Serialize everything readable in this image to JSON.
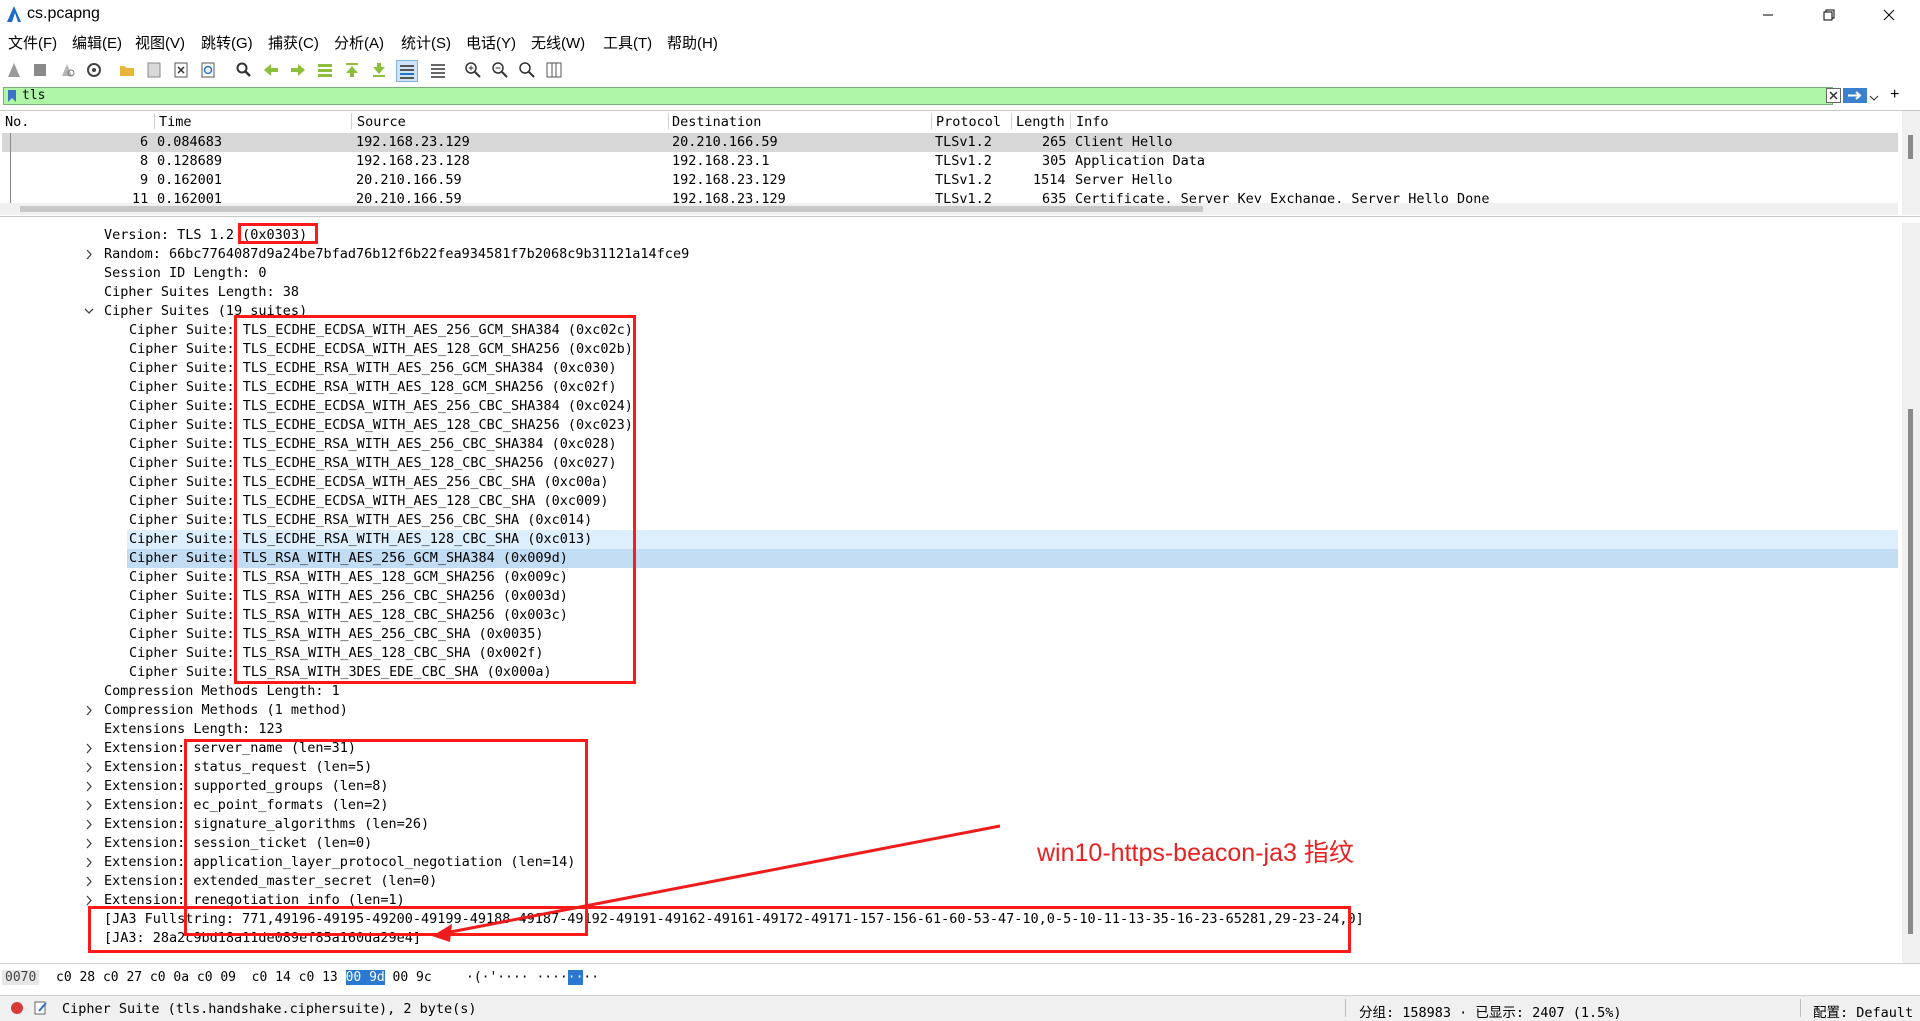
{
  "window": {
    "title": "cs.pcapng"
  },
  "menu": [
    "文件(F)",
    "编辑(E)",
    "视图(V)",
    "跳转(G)",
    "捕获(C)",
    "分析(A)",
    "统计(S)",
    "电话(Y)",
    "无线(W)",
    "工具(T)",
    "帮助(H)"
  ],
  "filter": {
    "value": "tls"
  },
  "packet_list": {
    "columns": [
      "No.",
      "Time",
      "Source",
      "Destination",
      "Protocol",
      "Length",
      "Info"
    ],
    "rows": [
      {
        "no": "6",
        "time": "0.084683",
        "src": "192.168.23.129",
        "dst": "20.210.166.59",
        "proto": "TLSv1.2",
        "len": "265",
        "info": "Client Hello",
        "selected": true
      },
      {
        "no": "8",
        "time": "0.128689",
        "src": "192.168.23.128",
        "dst": "192.168.23.1",
        "proto": "TLSv1.2",
        "len": "305",
        "info": "Application Data"
      },
      {
        "no": "9",
        "time": "0.162001",
        "src": "20.210.166.59",
        "dst": "192.168.23.129",
        "proto": "TLSv1.2",
        "len": "1514",
        "info": "Server Hello"
      },
      {
        "no": "11",
        "time": "0.162001",
        "src": "20.210.166.59",
        "dst": "192.168.23.129",
        "proto": "TLSv1.2",
        "len": "635",
        "info": "Certificate, Server Key Exchange, Server Hello Done"
      }
    ]
  },
  "details": {
    "version": {
      "label": "Version: TLS 1.2 ",
      "value": "(0x0303)"
    },
    "random": "Random: 66bc7764087d9a24be7bfad76b12f6b22fea934581f7b2068c9b31121a14fce9",
    "session_id_length": "Session ID Length: 0",
    "cipher_suites_length": "Cipher Suites Length: 38",
    "cipher_suites_header": "Cipher Suites (19 suites)",
    "cipher_prefix": "Cipher Suite: ",
    "cipher_suites": [
      "TLS_ECDHE_ECDSA_WITH_AES_256_GCM_SHA384 (0xc02c)",
      "TLS_ECDHE_ECDSA_WITH_AES_128_GCM_SHA256 (0xc02b)",
      "TLS_ECDHE_RSA_WITH_AES_256_GCM_SHA384 (0xc030)",
      "TLS_ECDHE_RSA_WITH_AES_128_GCM_SHA256 (0xc02f)",
      "TLS_ECDHE_ECDSA_WITH_AES_256_CBC_SHA384 (0xc024)",
      "TLS_ECDHE_ECDSA_WITH_AES_128_CBC_SHA256 (0xc023)",
      "TLS_ECDHE_RSA_WITH_AES_256_CBC_SHA384 (0xc028)",
      "TLS_ECDHE_RSA_WITH_AES_128_CBC_SHA256 (0xc027)",
      "TLS_ECDHE_ECDSA_WITH_AES_256_CBC_SHA (0xc00a)",
      "TLS_ECDHE_ECDSA_WITH_AES_128_CBC_SHA (0xc009)",
      "TLS_ECDHE_RSA_WITH_AES_256_CBC_SHA (0xc014)",
      "TLS_ECDHE_RSA_WITH_AES_128_CBC_SHA (0xc013)",
      "TLS_RSA_WITH_AES_256_GCM_SHA384 (0x009d)",
      "TLS_RSA_WITH_AES_128_GCM_SHA256 (0x009c)",
      "TLS_RSA_WITH_AES_256_CBC_SHA256 (0x003d)",
      "TLS_RSA_WITH_AES_128_CBC_SHA256 (0x003c)",
      "TLS_RSA_WITH_AES_256_CBC_SHA (0x0035)",
      "TLS_RSA_WITH_AES_128_CBC_SHA (0x002f)",
      "TLS_RSA_WITH_3DES_EDE_CBC_SHA (0x000a)"
    ],
    "compression_methods_length": "Compression Methods Length: 1",
    "compression_methods": "Compression Methods (1 method)",
    "extensions_length": "Extensions Length: 123",
    "extension_prefix": "Extension: ",
    "extensions": [
      "server_name (len=31)",
      "status_request (len=5)",
      "supported_groups (len=8)",
      "ec_point_formats (len=2)",
      "signature_algorithms (len=26)",
      "session_ticket (len=0)",
      "application_layer_protocol_negotiation (len=14)",
      "extended_master_secret (len=0)",
      "renegotiation_info (len=1)"
    ],
    "ja3_full": "[JA3 Fullstring: 771,49196-49195-49200-49199-49188-49187-49192-49191-49162-49161-49172-49171-157-156-61-60-53-47-10,0-5-10-11-13-35-16-23-65281,29-23-24,0]",
    "ja3": "[JA3: 28a2c9bd18a11de089ef85a160da29e4]"
  },
  "annotation": "win10-https-beacon-ja3 指纹",
  "bytes": {
    "offset": "0070",
    "hex_before": "c0 28 c0 27 c0 0a c0 09  c0 14 c0 13 ",
    "hex_sel": "00 9d",
    "hex_after": " 00 9c",
    "ascii_before": "·(·'···· ····",
    "ascii_sel": "··",
    "ascii_after": "··"
  },
  "status": {
    "field": "Cipher Suite (tls.handshake.ciphersuite), 2 byte(s)",
    "packets": "分组: 158983 · 已显示: 2407 (1.5%)",
    "profile": "配置: Default"
  },
  "colors": {
    "filter_bg": "#aff5a6",
    "annotation": "#e82222",
    "redbox": "#ff1a1a",
    "selection": "#2b78d0"
  }
}
